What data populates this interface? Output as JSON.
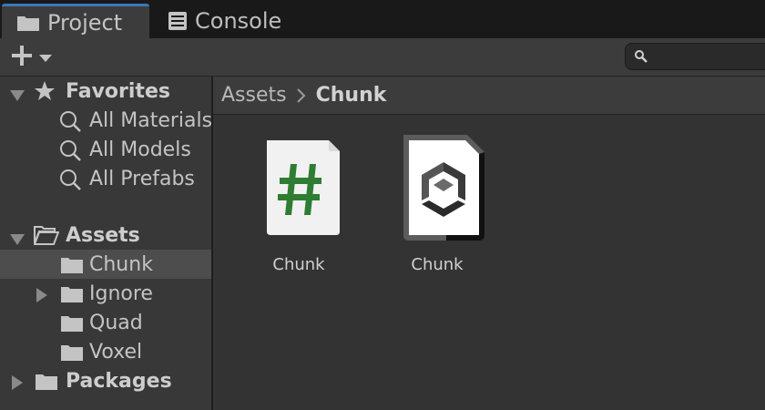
{
  "tabs": [
    {
      "label": "Project",
      "icon": "folder-icon",
      "active": true
    },
    {
      "label": "Console",
      "icon": "console-icon",
      "active": false
    }
  ],
  "toolbar": {
    "create_icon": "plus-icon",
    "dropdown_icon": "caret-down-icon",
    "search_value": "",
    "search_icon": "search-icon"
  },
  "sidebar": {
    "favorites": {
      "label": "Favorites",
      "items": [
        "All Materials",
        "All Models",
        "All Prefabs"
      ]
    },
    "assets": {
      "label": "Assets",
      "items": [
        {
          "label": "Chunk",
          "selected": true,
          "expandable": false
        },
        {
          "label": "Ignore",
          "selected": false,
          "expandable": true
        },
        {
          "label": "Quad",
          "selected": false,
          "expandable": false
        },
        {
          "label": "Voxel",
          "selected": false,
          "expandable": false
        }
      ]
    },
    "packages": {
      "label": "Packages"
    }
  },
  "breadcrumb": {
    "items": [
      "Assets",
      "Chunk"
    ],
    "separator_icon": "chevron-right-icon"
  },
  "assets_grid": [
    {
      "name": "Chunk",
      "type": "csharp-script",
      "icon": "csharp-script-icon"
    },
    {
      "name": "Chunk",
      "type": "prefab",
      "icon": "unity-prefab-icon"
    }
  ],
  "colors": {
    "selection": "#4d4d4d",
    "active_tab_accent": "#3a79bb",
    "script_hash": "#2e7d32"
  }
}
